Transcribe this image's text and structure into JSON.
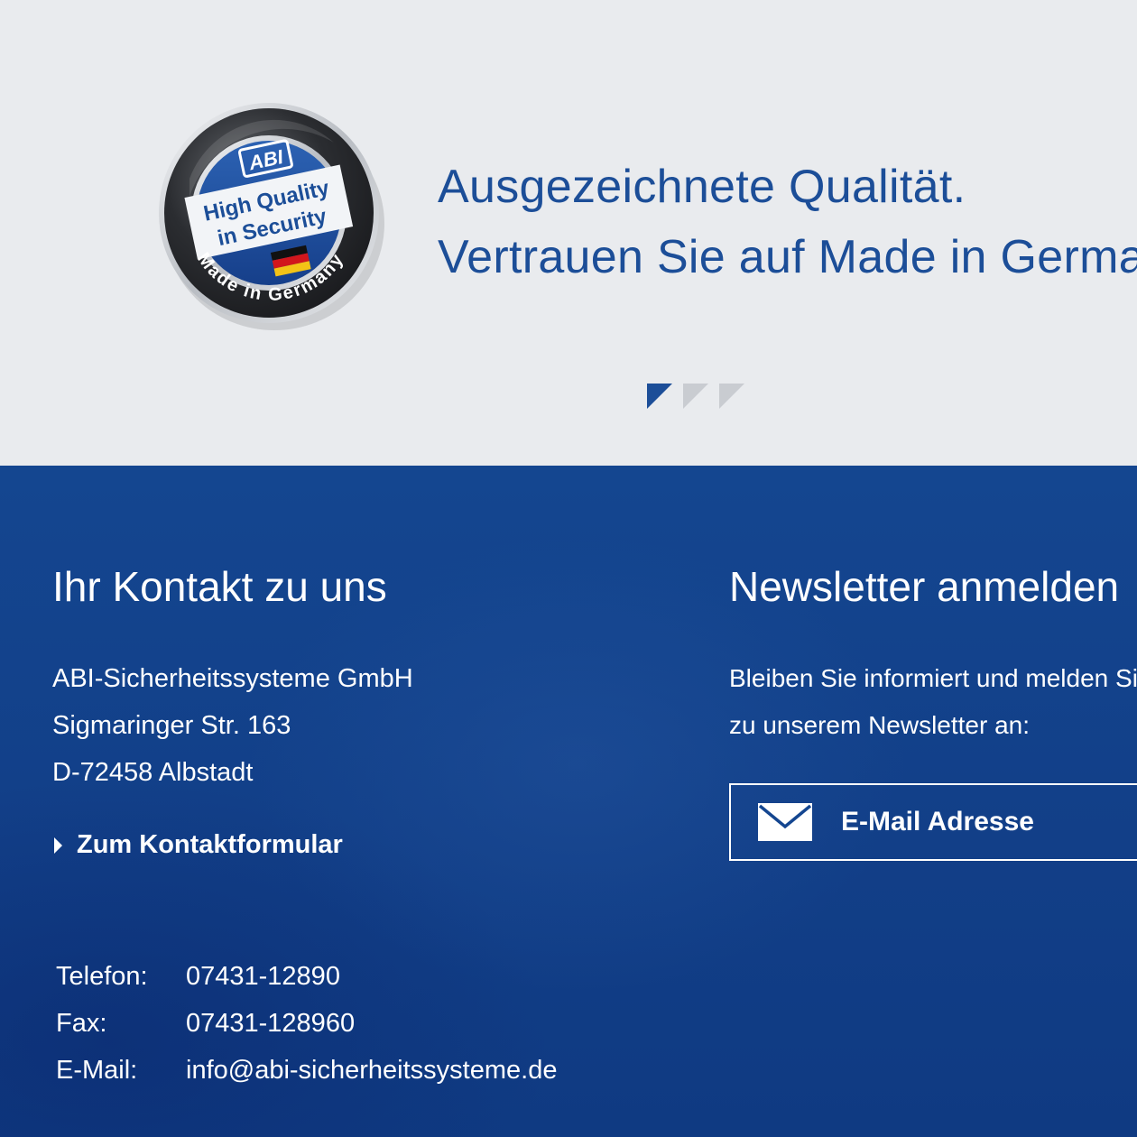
{
  "hero": {
    "seal": {
      "brand": "ABI",
      "line1": "High Quality",
      "line2": "in Security",
      "ring_text": "Made in Germany"
    },
    "headline_line1": "Ausgezeichnete Qualität.",
    "headline_line2": "Vertrauen Sie auf Made in Germany.",
    "slides_total": 3,
    "active_slide": 1
  },
  "contact": {
    "heading": "Ihr Kontakt zu uns",
    "company": "ABI-Sicherheitssysteme GmbH",
    "street": "Sigmaringer Str. 163",
    "city": "D-72458 Albstadt",
    "form_link": "Zum Kontaktformular",
    "phone_label": "Telefon:",
    "phone_value": "07431-12890",
    "fax_label": "Fax:",
    "fax_value": "07431-128960",
    "email_label": "E-Mail:",
    "email_value": "info@abi-sicherheitssysteme.de"
  },
  "newsletter": {
    "heading": "Newsletter anmelden",
    "text_line1": "Bleiben Sie informiert und melden Sie sich",
    "text_line2": "zu unserem Newsletter an:",
    "email_placeholder": "E-Mail Adresse"
  },
  "colors": {
    "hero_bg": "#e9ebee",
    "accent_blue": "#1c4e98",
    "footer_bg": "#144690",
    "pager_inactive": "#c9ccd1",
    "text_light": "#ffffff"
  },
  "icons": {
    "seal": "abi-quality-seal-icon",
    "arrow": "triangle-right-icon",
    "envelope": "envelope-icon"
  }
}
